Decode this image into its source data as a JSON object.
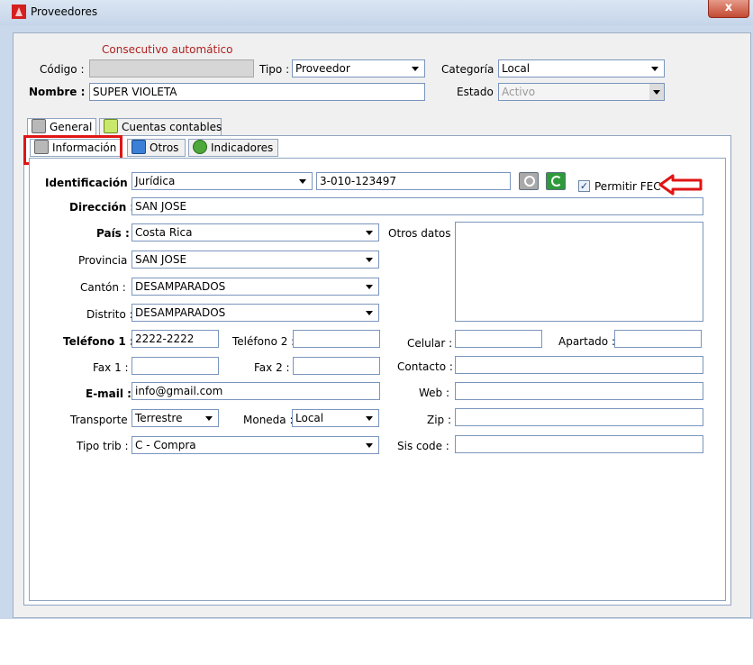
{
  "window": {
    "title": "Proveedores",
    "close_label": "x"
  },
  "header": {
    "auto_note": "Consecutivo automático",
    "codigo_label": "Código :",
    "codigo_value": "",
    "tipo_label": "Tipo :",
    "tipo_value": "Proveedor",
    "categoria_label": "Categoría :",
    "categoria_value": "Local",
    "nombre_label": "Nombre :",
    "nombre_value": "SUPER VIOLETA",
    "estado_label": "Estado :",
    "estado_value": "Activo"
  },
  "tabs": [
    {
      "label": "General",
      "icon": "magnifier-icon"
    },
    {
      "label": "Cuentas contables",
      "icon": "chart-icon"
    }
  ],
  "subtabs": [
    {
      "label": "Información",
      "icon": "magnifier-icon"
    },
    {
      "label": "Otros",
      "icon": "list-icon"
    },
    {
      "label": "Indicadores",
      "icon": "gauge-icon"
    }
  ],
  "form": {
    "identificacion_label": "Identificación :",
    "identificacion_tipo": "Jurídica",
    "identificacion_value": "3-010-123497",
    "permitir_fec_label": "Permitir FEC",
    "permitir_fec_checked": "✓",
    "direccion_label": "Dirección :",
    "direccion_value": "SAN JOSE",
    "pais_label": "País :",
    "pais_value": "Costa Rica",
    "otros_datos_label": "Otros datos :",
    "provincia_label": "Provincia :",
    "provincia_value": "SAN JOSE",
    "canton_label": "Cantón :",
    "canton_value": "DESAMPARADOS",
    "distrito_label": "Distrito :",
    "distrito_value": "DESAMPARADOS",
    "telefono1_label": "Teléfono 1 :",
    "telefono1_value": "2222-2222",
    "telefono2_label": "Teléfono 2 :",
    "telefono2_value": "",
    "celular_label": "Celular :",
    "apartado_label": "Apartado :",
    "fax1_label": "Fax 1 :",
    "fax2_label": "Fax 2 :",
    "contacto_label": "Contacto :",
    "email_label": "E-mail :",
    "email_value": "info@gmail.com",
    "web_label": "Web :",
    "transporte_label": "Transporte :",
    "transporte_value": "Terrestre",
    "moneda_label": "Moneda :",
    "moneda_value": "Local",
    "zip_label": "Zip :",
    "tipo_trib_label": "Tipo trib :",
    "tipo_trib_value": "C - Compra",
    "sis_code_label": "Sis code :"
  },
  "colors": {
    "highlight": "#e01515",
    "field_border": "#7a95bd",
    "window_frame": "#c9d8ea"
  }
}
